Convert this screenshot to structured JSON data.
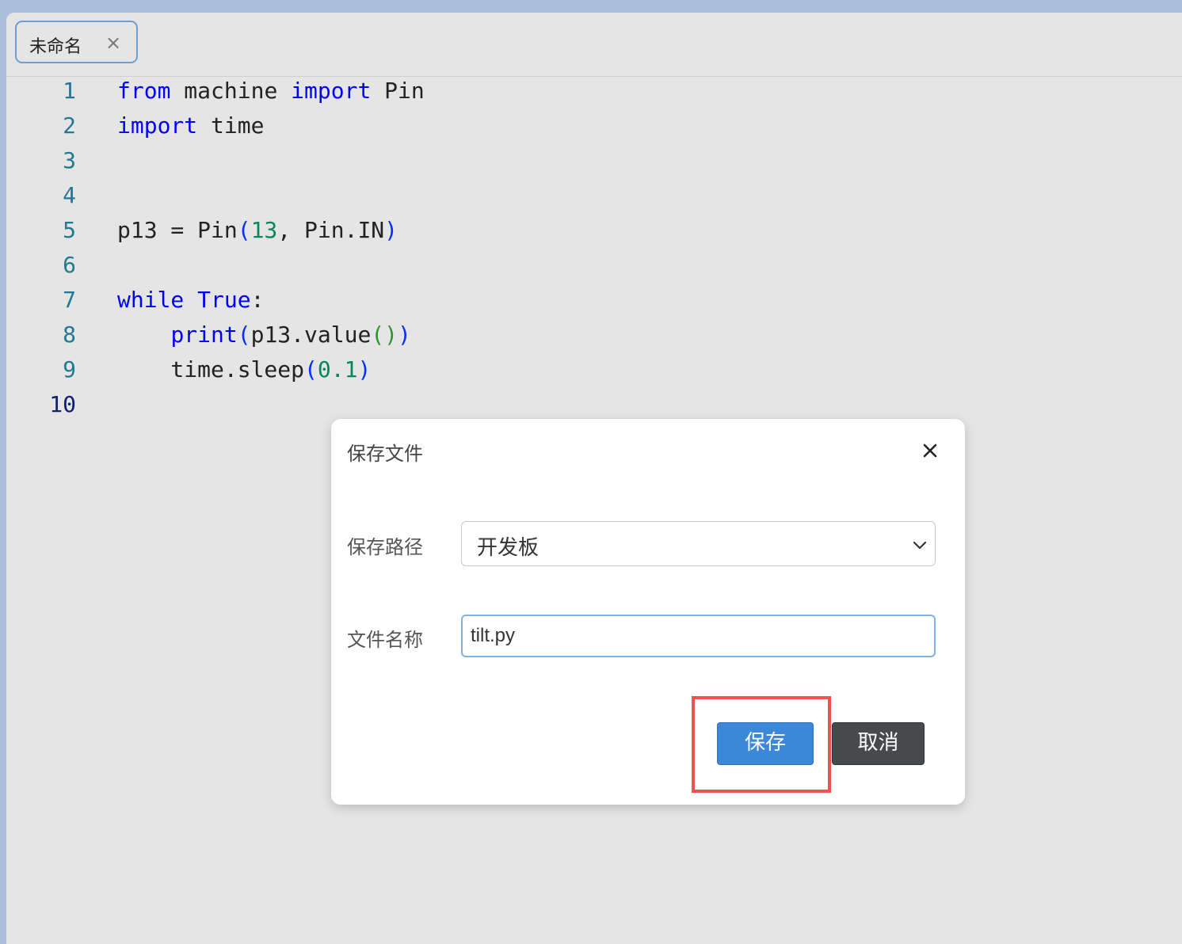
{
  "tab": {
    "title": "未命名",
    "close_glyph": "×"
  },
  "code": {
    "lines": [
      {
        "num": "1",
        "tokens": [
          {
            "t": "from",
            "c": "kw"
          },
          {
            "t": " machine ",
            "c": "plain"
          },
          {
            "t": "import",
            "c": "kw"
          },
          {
            "t": " Pin",
            "c": "plain"
          }
        ]
      },
      {
        "num": "2",
        "tokens": [
          {
            "t": "import",
            "c": "kw"
          },
          {
            "t": " time",
            "c": "plain"
          }
        ]
      },
      {
        "num": "3",
        "tokens": []
      },
      {
        "num": "4",
        "tokens": []
      },
      {
        "num": "5",
        "tokens": [
          {
            "t": "p13 = Pin",
            "c": "plain"
          },
          {
            "t": "(",
            "c": "b1"
          },
          {
            "t": "13",
            "c": "num"
          },
          {
            "t": ", Pin.IN",
            "c": "plain"
          },
          {
            "t": ")",
            "c": "b1"
          }
        ]
      },
      {
        "num": "6",
        "tokens": []
      },
      {
        "num": "7",
        "tokens": [
          {
            "t": "while",
            "c": "kw"
          },
          {
            "t": " ",
            "c": "plain"
          },
          {
            "t": "True",
            "c": "kw"
          },
          {
            "t": ":",
            "c": "plain"
          }
        ]
      },
      {
        "num": "8",
        "tokens": [
          {
            "t": "    ",
            "c": "plain"
          },
          {
            "t": "print",
            "c": "kw"
          },
          {
            "t": "(",
            "c": "b1"
          },
          {
            "t": "p13.value",
            "c": "plain"
          },
          {
            "t": "()",
            "c": "b2"
          },
          {
            "t": ")",
            "c": "b1"
          }
        ]
      },
      {
        "num": "9",
        "tokens": [
          {
            "t": "    time.sleep",
            "c": "plain"
          },
          {
            "t": "(",
            "c": "b1"
          },
          {
            "t": "0.1",
            "c": "num"
          },
          {
            "t": ")",
            "c": "b1"
          }
        ]
      },
      {
        "num": "10",
        "active": true,
        "tokens": []
      }
    ]
  },
  "dialog": {
    "title": "保存文件",
    "path_label": "保存路径",
    "path_value": "开发板",
    "name_label": "文件名称",
    "name_value": "tilt.py",
    "save_label": "保存",
    "cancel_label": "取消",
    "close_icon": "close-icon",
    "chevron_icon": "chevron-down-icon"
  },
  "colors": {
    "keyword": "#0000ff",
    "number": "#098658",
    "bracket_1": "#0431fa",
    "bracket_2": "#319331",
    "save_button": "#3b88d8",
    "cancel_button": "#474a4d",
    "highlight": "#ef5350"
  }
}
